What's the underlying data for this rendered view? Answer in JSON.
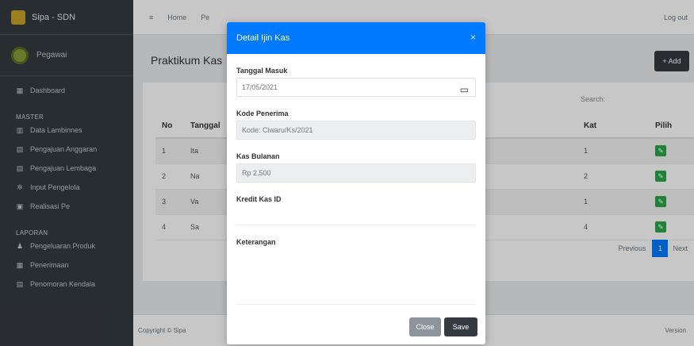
{
  "brand": {
    "name": "Sipa - SDN"
  },
  "user": {
    "name": "Pegawai"
  },
  "sidebar": {
    "dashboard": "Dashboard",
    "section_master": "MASTER",
    "items": [
      "Data Lambinnes",
      "Pengajuan Anggaran",
      "Pengajuan Lembaga",
      "Input Pengelola",
      "Realisasi Pe"
    ],
    "section_laporan": "LAPORAN",
    "report_items": [
      "Pengeluaran Produk",
      "Penerimaan",
      "Penomoran Kendala"
    ]
  },
  "topbar": {
    "home": "Home",
    "link2": "Pe",
    "right": "Log out"
  },
  "page": {
    "title": "Praktikum Kas",
    "add_label": "+ Add"
  },
  "table": {
    "search_label": "Search:",
    "headers": [
      "No",
      "Tanggal",
      "Kat",
      "Pilih"
    ],
    "rows": [
      {
        "no": "1",
        "name": "Ita",
        "kat": "1"
      },
      {
        "no": "2",
        "name": "Na",
        "kat": "2"
      },
      {
        "no": "3",
        "name": "Va",
        "kat": "1"
      },
      {
        "no": "4",
        "name": "Sa",
        "kat": "4"
      }
    ]
  },
  "pager": {
    "prev": "Previous",
    "page": "1",
    "next": "Next"
  },
  "footer": {
    "left": "Copyright © Sipa",
    "right": "Version"
  },
  "modal": {
    "title": "Detail Ijin Kas",
    "close_glyph": "×",
    "fields": [
      {
        "label": "Tanggal Masuk",
        "value": "17/05/2021"
      },
      {
        "label": "Kode Penerima",
        "value": "Kode: Ciwaru/Ks/2021"
      },
      {
        "label": "Kas Bulanan",
        "value": "Rp 2.500"
      },
      {
        "label": "Kredit Kas ID",
        "value": ""
      },
      {
        "label": "Keterangan",
        "value": ""
      }
    ],
    "btn_close": "Close",
    "btn_save": "Save"
  }
}
